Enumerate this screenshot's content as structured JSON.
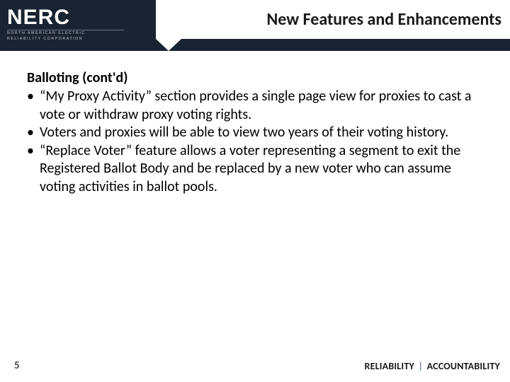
{
  "logo": {
    "name": "NERC",
    "tagline_line1": "NORTH AMERICAN ELECTRIC",
    "tagline_line2": "RELIABILITY CORPORATION"
  },
  "title": "New Features and Enhancements",
  "section_heading": "Balloting (cont'd)",
  "bullets": [
    "“My Proxy Activity” section provides a single page view for proxies to cast a vote or withdraw proxy voting rights.",
    "Voters and proxies will be able to view two years of their voting history.",
    "“Replace Voter” feature allows a voter representing a segment to exit the Registered Ballot Body and be replaced by a new voter who can assume voting activities in ballot pools."
  ],
  "page_number": "5",
  "footer": {
    "left": "RELIABILITY",
    "sep": "|",
    "right": "ACCOUNTABILITY"
  }
}
